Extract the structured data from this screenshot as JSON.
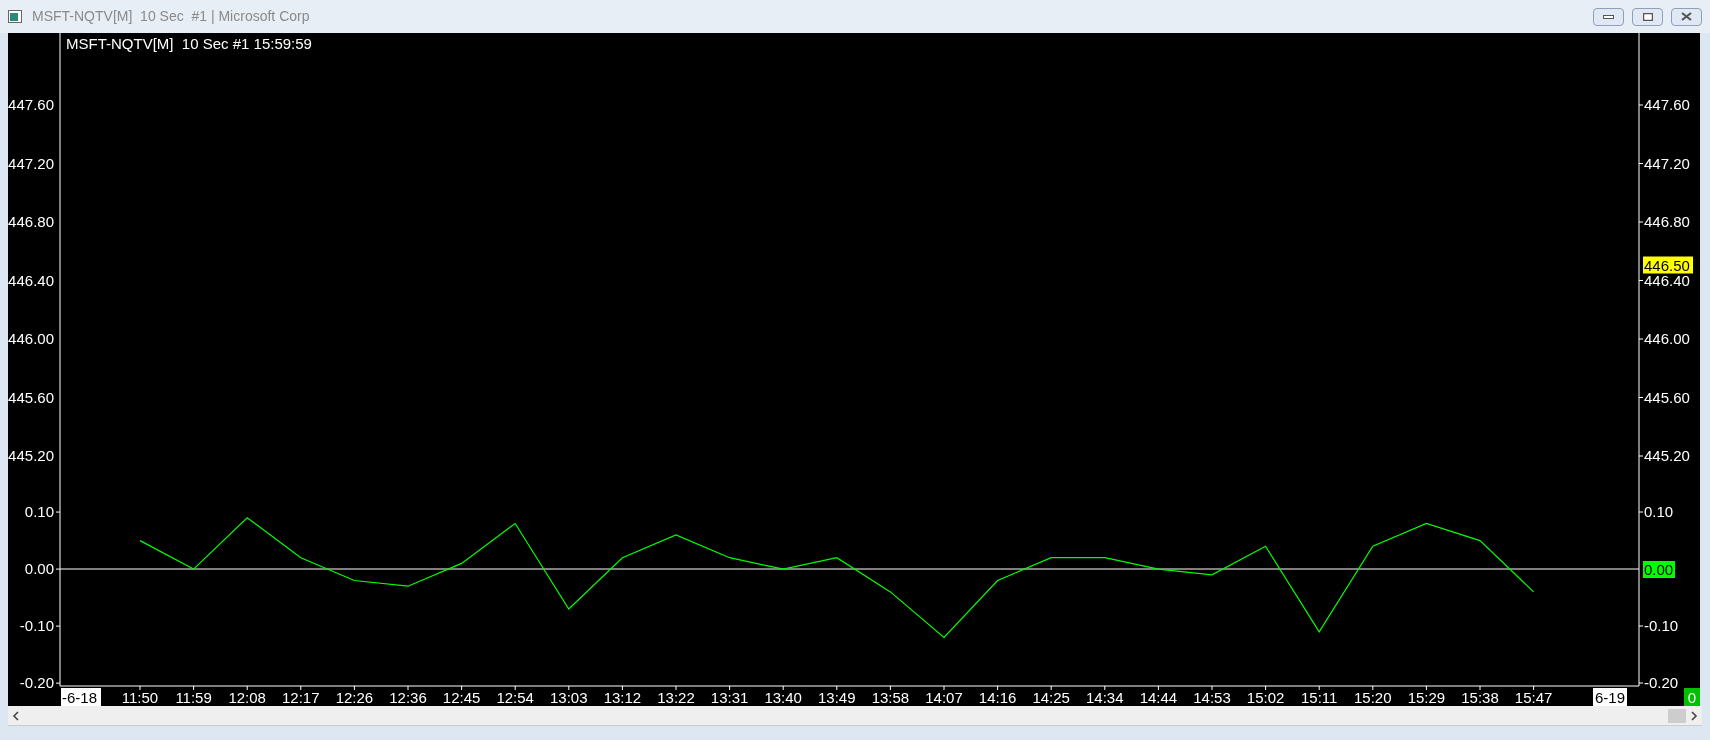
{
  "window": {
    "title": "MSFT-NQTV[M]  10 Sec  #1 | Microsoft Corp"
  },
  "chart": {
    "header": "MSFT-NQTV[M]  10 Sec #1 15:59:59",
    "left_axis": {
      "price_ticks": [
        "447.60",
        "447.20",
        "446.80",
        "446.40",
        "446.00",
        "445.60",
        "445.20"
      ]
    },
    "right_axis": {
      "price_ticks": [
        "447.60",
        "447.20",
        "446.80",
        "446.40",
        "446.00",
        "445.60",
        "445.20"
      ],
      "indicator_ticks": [
        "0.10",
        "-0.10",
        "-0.20"
      ],
      "last_price": "446.50",
      "last_value": "0.00"
    },
    "x_axis": {
      "start_label": "-6-18",
      "end_label": "6-19"
    },
    "indicator": {
      "chart_data": {
        "type": "line",
        "categories": [
          "11:50",
          "11:59",
          "12:08",
          "12:17",
          "12:26",
          "12:36",
          "12:45",
          "12:54",
          "13:03",
          "13:12",
          "13:22",
          "13:31",
          "13:40",
          "13:49",
          "13:58",
          "14:07",
          "14:16",
          "14:25",
          "14:34",
          "14:44",
          "14:53",
          "15:02",
          "15:11",
          "15:20",
          "15:29",
          "15:38",
          "15:47"
        ],
        "series": [
          {
            "color": "#00ff00",
            "values": [
              0.05,
              0.0,
              0.09,
              0.02,
              -0.02,
              -0.03,
              0.01,
              0.08,
              -0.07,
              0.02,
              0.06,
              0.02,
              0.0,
              0.02,
              -0.04,
              -0.12,
              -0.02,
              0.02,
              0.02,
              0.0,
              -0.01,
              0.04,
              -0.11,
              0.04,
              0.08,
              0.05,
              -0.04
            ]
          }
        ],
        "ylim": [
          -0.205,
          0.94
        ],
        "yticks": [
          {
            "value": 0.1,
            "label": "0.10"
          },
          {
            "value": 0,
            "label": "0.00"
          },
          {
            "value": -0.1,
            "label": "-0.10"
          },
          {
            "value": -0.2,
            "label": "-0.20"
          }
        ]
      }
    },
    "corner_badge": "0"
  }
}
